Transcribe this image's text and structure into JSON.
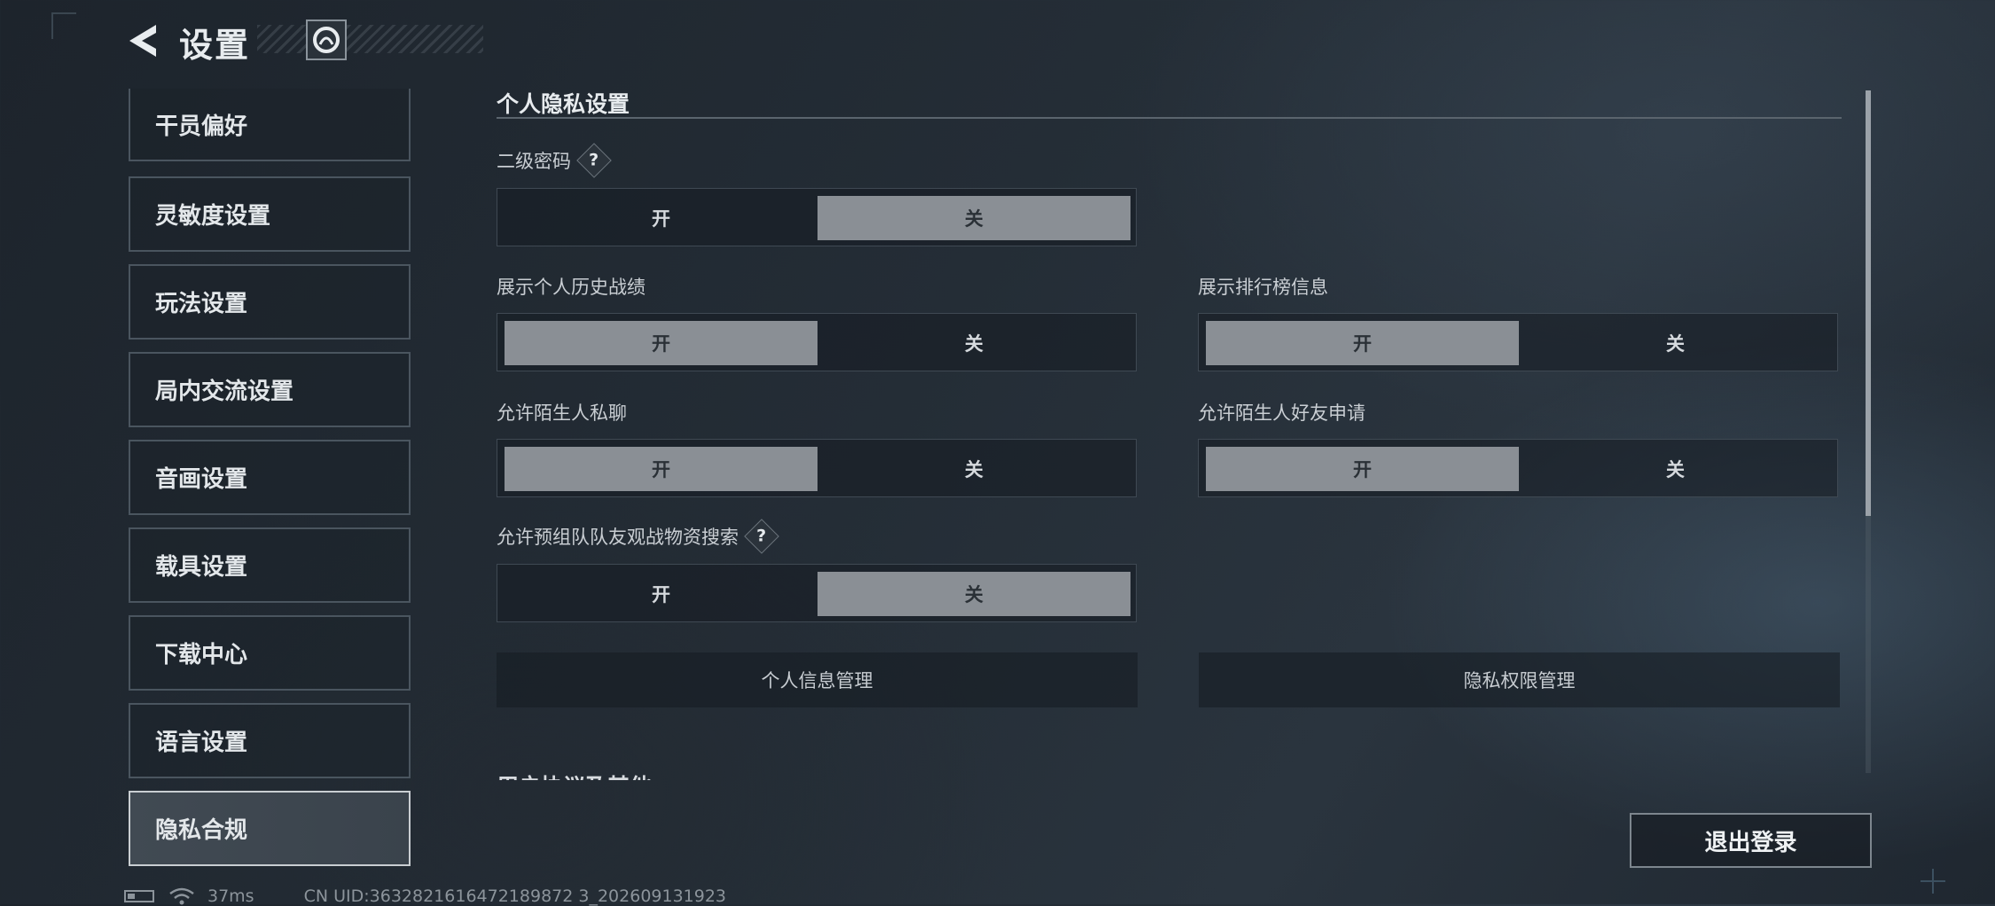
{
  "header": {
    "title": "设置",
    "back_icon": "back-arrow-icon",
    "avatar_icon": "game-logo-icon"
  },
  "sidebar": {
    "items": [
      {
        "label": "干员偏好",
        "active": false
      },
      {
        "label": "灵敏度设置",
        "active": false
      },
      {
        "label": "玩法设置",
        "active": false
      },
      {
        "label": "局内交流设置",
        "active": false
      },
      {
        "label": "音画设置",
        "active": false
      },
      {
        "label": "载具设置",
        "active": false
      },
      {
        "label": "下载中心",
        "active": false
      },
      {
        "label": "语言设置",
        "active": false
      },
      {
        "label": "隐私合规",
        "active": true
      }
    ]
  },
  "privacy": {
    "section_title": "个人隐私设置",
    "on_label": "开",
    "off_label": "关",
    "settings": [
      {
        "label": "二级密码",
        "has_help": true,
        "value": "关"
      },
      {
        "label": "展示个人历史战绩",
        "has_help": false,
        "value": "开"
      },
      {
        "label": "展示排行榜信息",
        "has_help": false,
        "value": "开"
      },
      {
        "label": "允许陌生人私聊",
        "has_help": false,
        "value": "开"
      },
      {
        "label": "允许陌生人好友申请",
        "has_help": false,
        "value": "开"
      },
      {
        "label": "允许预组队队友观战物资搜索",
        "has_help": true,
        "value": "关"
      }
    ],
    "buttons": {
      "personal_info": "个人信息管理",
      "privacy_permissions": "隐私权限管理"
    },
    "next_section_title": "用户协议及其他",
    "help_glyph": "?"
  },
  "footer": {
    "logout_label": "退出登录",
    "ping": "37ms",
    "uid": "CN UID:3632821616472189872 3_202609131923"
  },
  "colors": {
    "toggle_on": "#8a8f95",
    "background": "#242d36",
    "text": "#d5d9dd"
  }
}
